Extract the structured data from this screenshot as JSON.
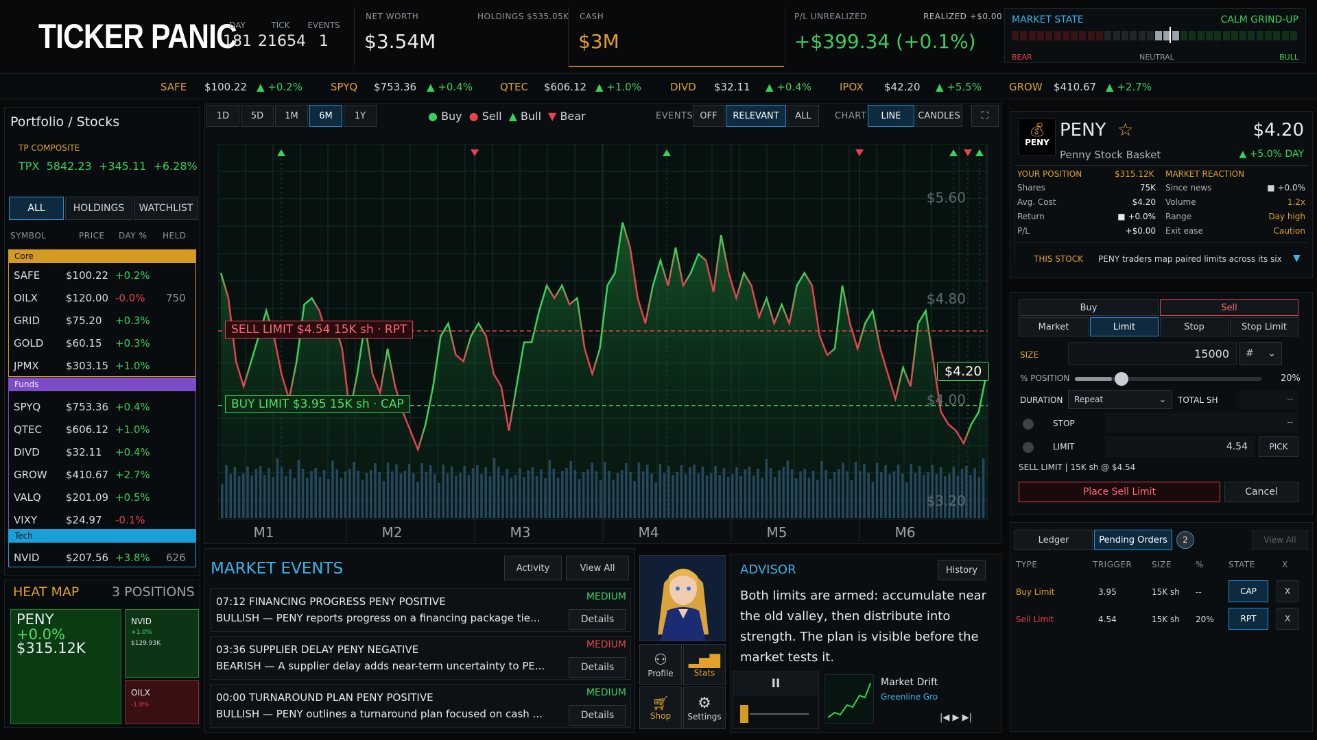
{
  "header": {
    "logo": "TICKER PANIC",
    "day_label": "DAY",
    "day": "181",
    "tick_label": "TICK",
    "tick": "21654",
    "events_label": "EVENTS",
    "events": "1",
    "net_worth_label": "NET WORTH",
    "net_worth": "$3.54M",
    "holdings_label": "HOLDINGS $535.05K",
    "cash_label": "CASH",
    "cash": "$3M",
    "pl_label": "P/L UNREALIZED",
    "pl": "+$399.34 (+0.1%)",
    "realized_label": "REALIZED +$0.00",
    "market_state_label": "MARKET STATE",
    "market_state": "CALM GRIND-UP",
    "bear": "BEAR",
    "neutral": "NEUTRAL",
    "bull": "BULL",
    "market_level": 0.55
  },
  "ticker": [
    {
      "sym": "SAFE",
      "price": "$100.22",
      "chg": "▲ +0.2%"
    },
    {
      "sym": "SPYQ",
      "price": "$753.36",
      "chg": "▲ +0.4%"
    },
    {
      "sym": "QTEC",
      "price": "$606.12",
      "chg": "▲ +1.0%"
    },
    {
      "sym": "DIVD",
      "price": "$32.11",
      "chg": "▲ +0.4%"
    },
    {
      "sym": "IPOX",
      "price": "$42.20",
      "chg": "▲ +5.5%"
    },
    {
      "sym": "GROW",
      "price": "$410.67",
      "chg": "▲ +2.7%"
    }
  ],
  "left": {
    "title": "Portfolio / Stocks",
    "composite_label": "TP COMPOSITE",
    "composite_sym": "TPX",
    "composite_val": "5842.23",
    "composite_chg": "+345.11",
    "composite_pct": "+6.28%",
    "tabs": [
      "ALL",
      "HOLDINGS",
      "WATCHLIST"
    ],
    "cols": [
      "SYMBOL",
      "PRICE",
      "DAY %",
      "HELD"
    ],
    "core_label": "Core",
    "funds_label": "Funds",
    "tech_label": "Tech",
    "core": [
      {
        "sym": "SAFE",
        "price": "$100.22",
        "day": "+0.2%",
        "held": ""
      },
      {
        "sym": "OILX",
        "price": "$120.00",
        "day": "-0.0%",
        "held": "750"
      },
      {
        "sym": "GRID",
        "price": "$75.20",
        "day": "+0.3%",
        "held": ""
      },
      {
        "sym": "GOLD",
        "price": "$60.15",
        "day": "+0.3%",
        "held": ""
      },
      {
        "sym": "JPMX",
        "price": "$303.15",
        "day": "+1.0%",
        "held": ""
      }
    ],
    "funds": [
      {
        "sym": "SPYQ",
        "price": "$753.36",
        "day": "+0.4%",
        "held": ""
      },
      {
        "sym": "QTEC",
        "price": "$606.12",
        "day": "+1.0%",
        "held": ""
      },
      {
        "sym": "DIVD",
        "price": "$32.11",
        "day": "+0.4%",
        "held": ""
      },
      {
        "sym": "GROW",
        "price": "$410.67",
        "day": "+2.7%",
        "held": ""
      },
      {
        "sym": "VALQ",
        "price": "$201.09",
        "day": "+0.5%",
        "held": ""
      },
      {
        "sym": "VIXY",
        "price": "$24.97",
        "day": "-0.1%",
        "held": ""
      }
    ],
    "tech": [
      {
        "sym": "NVID",
        "price": "$207.56",
        "day": "+3.8%",
        "held": "626"
      }
    ],
    "heat_title": "HEAT MAP",
    "positions": "3 POSITIONS",
    "heat": {
      "big_sym": "PENY",
      "big_pct": "+0.0%",
      "big_val": "$315.12K",
      "nvid": "NVID",
      "nvid_pct": "+1.0%",
      "nvid_val": "$129.93K",
      "oilx": "OILX",
      "oilx_pct": "-1.0%"
    }
  },
  "chart": {
    "ranges": [
      "1D",
      "5D",
      "1M",
      "6M",
      "1Y"
    ],
    "legend": [
      "Buy",
      "Sell",
      "Bull",
      "Bear"
    ],
    "events_label": "EVENTS",
    "events_opts": [
      "OFF",
      "RELEVANT",
      "ALL"
    ],
    "chart_label": "CHART",
    "chart_opts": [
      "LINE",
      "CANDLES"
    ],
    "fullscreen": "⛶",
    "sell_limit": "SELL LIMIT  $4.54  15K sh · RPT",
    "buy_limit": "BUY LIMIT  $3.95  15K sh · CAP",
    "price_tag": "$4.20",
    "yticks": [
      "$5.60",
      "$4.80",
      "$4.00",
      "$3.20"
    ],
    "months": [
      "M1",
      "M2",
      "M3",
      "M4",
      "M5",
      "M6"
    ]
  },
  "chart_data": {
    "type": "line",
    "ylim": [
      3.2,
      6.0
    ],
    "yticks": [
      5.6,
      4.8,
      4.0,
      3.2
    ],
    "xlabels": [
      "M1",
      "M2",
      "M3",
      "M4",
      "M5",
      "M6"
    ],
    "sell_limit": 4.54,
    "buy_limit": 3.95,
    "last": 4.2,
    "values": [
      5.0,
      4.8,
      4.3,
      4.1,
      4.3,
      4.5,
      4.7,
      4.5,
      4.2,
      4.0,
      4.3,
      4.75,
      4.8,
      4.7,
      4.5,
      4.6,
      4.4,
      3.9,
      4.2,
      4.6,
      4.2,
      4.05,
      4.4,
      4.1,
      3.9,
      3.75,
      3.6,
      3.8,
      4.1,
      4.5,
      4.6,
      4.35,
      4.3,
      4.5,
      4.6,
      4.5,
      4.2,
      4.1,
      3.75,
      4.1,
      4.45,
      4.45,
      4.7,
      4.9,
      4.8,
      4.9,
      4.75,
      4.8,
      4.4,
      4.2,
      4.4,
      4.9,
      5.0,
      5.4,
      5.2,
      4.8,
      4.6,
      4.9,
      5.1,
      4.9,
      5.2,
      4.9,
      5.0,
      5.15,
      5.1,
      4.85,
      5.3,
      5.0,
      4.8,
      5.0,
      4.9,
      4.65,
      4.8,
      4.6,
      4.75,
      4.6,
      4.9,
      5.0,
      4.9,
      4.5,
      4.35,
      4.4,
      4.9,
      4.6,
      4.4,
      4.6,
      4.7,
      4.4,
      4.2,
      4.0,
      4.25,
      4.1,
      4.6,
      4.7,
      4.3,
      3.9,
      3.8,
      3.75,
      3.65,
      3.8,
      3.9,
      4.2
    ]
  },
  "right": {
    "logo_text": "PENY",
    "sym": "PENY",
    "star": "☆",
    "name": "Penny Stock Basket",
    "price": "$4.20",
    "chg": "▲ +5.0% DAY",
    "your_position": "YOUR POSITION",
    "position_val": "$315.12K",
    "market_reaction": "MARKET REACTION",
    "pos_rows": [
      [
        "Shares",
        "75K"
      ],
      [
        "Avg. Cost",
        "$4.20"
      ],
      [
        "Return",
        "■ +0.0%"
      ],
      [
        "P/L",
        "+$0.00"
      ]
    ],
    "react_rows": [
      [
        "Since news",
        "■ +0.0%"
      ],
      [
        "Volume",
        "1.2x"
      ],
      [
        "Range",
        "Day high"
      ],
      [
        "Exit ease",
        "Caution"
      ]
    ],
    "this_stock": "THIS STOCK",
    "this_stock_text": "PENY traders map paired limits across its six",
    "order": {
      "buy": "Buy",
      "sell": "Sell",
      "types": [
        "Market",
        "Limit",
        "Stop",
        "Stop Limit"
      ],
      "size_label": "SIZE",
      "size": "15000",
      "size_unit": "#",
      "pct_label": "% POSITION",
      "pct": "20%",
      "pct_fill": 0.2,
      "duration_label": "DURATION",
      "duration": "Repeat",
      "total_label": "TOTAL SH",
      "total": "--",
      "stop_label": "STOP",
      "stop": "--",
      "limit_label": "LIMIT",
      "limit": "4.54",
      "pick": "PICK",
      "summary": "SELL LIMIT | 15K sh @ $4.54",
      "place": "Place Sell Limit",
      "cancel": "Cancel"
    },
    "ledger_tab": "Ledger",
    "pending_tab": "Pending Orders",
    "pending_count": "2",
    "view_all": "View All",
    "orders_cols": [
      "TYPE",
      "TRIGGER",
      "SIZE",
      "%",
      "STATE",
      "X"
    ],
    "orders": [
      {
        "type": "Buy Limit",
        "trigger": "3.95",
        "size": "15K sh",
        "pct": "--",
        "state": "CAP",
        "x": "X"
      },
      {
        "type": "Sell Limit",
        "trigger": "4.54",
        "size": "15K sh",
        "pct": "20%",
        "state": "RPT",
        "x": "X"
      }
    ]
  },
  "events": {
    "title": "MARKET EVENTS",
    "activity": "Activity",
    "view_all": "View All",
    "details": "Details",
    "items": [
      {
        "head": "07:12  FINANCING PROGRESS  PENY  POSITIVE",
        "sev": "MEDIUM",
        "body": "BULLISH — PENY reports progress on a financing package tie..."
      },
      {
        "head": "03:36  SUPPLIER DELAY  PENY  NEGATIVE",
        "sev": "MEDIUM",
        "body": "BEARISH — A supplier delay adds near-term uncertainty to PE..."
      },
      {
        "head": "00:00  TURNAROUND PLAN  PENY  POSITIVE",
        "sev": "MEDIUM",
        "body": "BULLISH — PENY outlines a turnaround plan focused on cash ..."
      }
    ]
  },
  "advisor": {
    "profile": "Profile",
    "stats": "Stats",
    "shop": "Shop",
    "settings": "Settings",
    "title": "ADVISOR",
    "history": "History",
    "text": "Both limits are armed: accumulate near the old valley, then distribute into strength. The plan is visible before the market tests it.",
    "pause": "II",
    "track": "Market Drift",
    "artist": "Greenline Gro",
    "controls": "|◀  ▶  ▶|"
  }
}
